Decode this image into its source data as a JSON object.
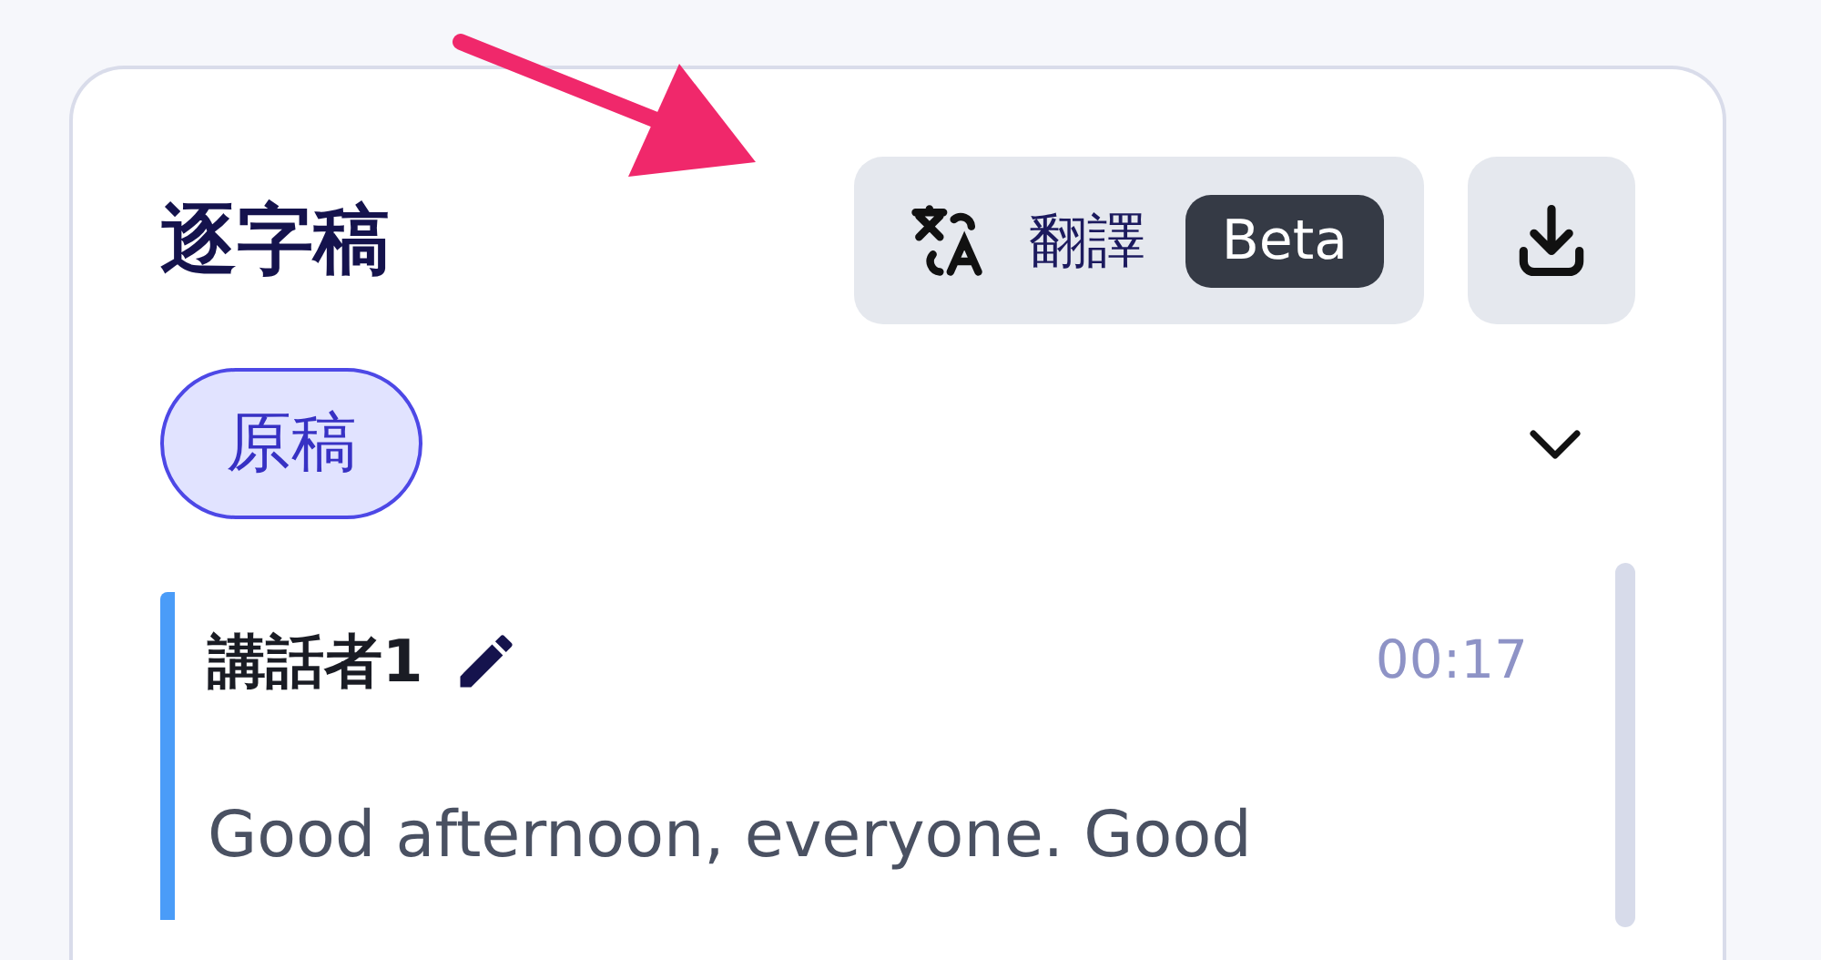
{
  "panel": {
    "title": "逐字稿",
    "translate_button": {
      "label": "翻譯",
      "badge": "Beta"
    },
    "version_chip": {
      "label": "原稿",
      "selected": true
    },
    "segments": [
      {
        "speaker": "講話者1",
        "time": "00:17",
        "text": "Good afternoon, everyone. Good"
      }
    ]
  }
}
